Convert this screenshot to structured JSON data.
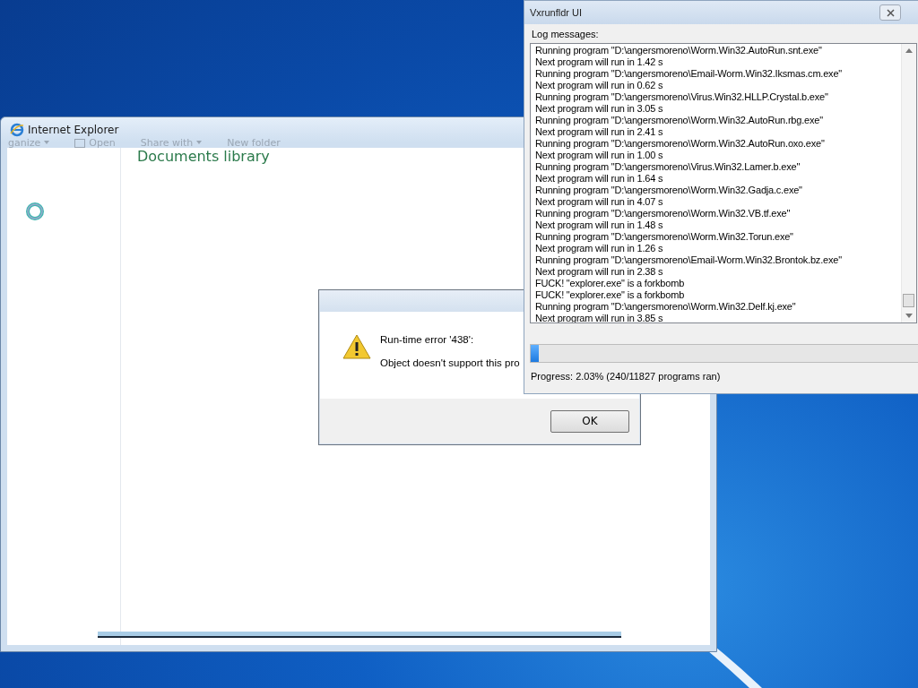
{
  "ie_window": {
    "title": "Internet Explorer",
    "toolbar": [
      {
        "label": "ganize",
        "kind": "dropdown"
      },
      {
        "label": "Open",
        "kind": "icon"
      },
      {
        "label": "Share with",
        "kind": "dropdown"
      },
      {
        "label": "New folder",
        "kind": "plain"
      }
    ],
    "heading": "Documents library"
  },
  "error_dialog": {
    "heading": "Run-time error '438':",
    "message": "Object doesn't support this pro",
    "buttons": [
      "OK"
    ]
  },
  "runner_window": {
    "title": "Vxrunfldr UI",
    "log_label": "Log messages:",
    "log": [
      "Running program \"D:\\angersmoreno\\Worm.Win32.AutoRun.snt.exe\"",
      "Next program will run in 1.42 s",
      "Running program \"D:\\angersmoreno\\Email-Worm.Win32.Iksmas.cm.exe\"",
      "Next program will run in 0.62 s",
      "Running program \"D:\\angersmoreno\\Virus.Win32.HLLP.Crystal.b.exe\"",
      "Next program will run in 3.05 s",
      "Running program \"D:\\angersmoreno\\Worm.Win32.AutoRun.rbg.exe\"",
      "Next program will run in 2.41 s",
      "Running program \"D:\\angersmoreno\\Worm.Win32.AutoRun.oxo.exe\"",
      "Next program will run in 1.00 s",
      "Running program \"D:\\angersmoreno\\Virus.Win32.Lamer.b.exe\"",
      "Next program will run in 1.64 s",
      "Running program \"D:\\angersmoreno\\Worm.Win32.Gadja.c.exe\"",
      "Next program will run in 4.07 s",
      "Running program \"D:\\angersmoreno\\Worm.Win32.VB.tf.exe\"",
      "Next program will run in 1.48 s",
      "Running program \"D:\\angersmoreno\\Worm.Win32.Torun.exe\"",
      "Next program will run in 1.26 s",
      "Running program \"D:\\angersmoreno\\Email-Worm.Win32.Brontok.bz.exe\"",
      "Next program will run in 2.38 s",
      "FUCK! \"explorer.exe\" is a forkbomb",
      "FUCK! \"explorer.exe\" is a forkbomb",
      "Running program \"D:\\angersmoreno\\Worm.Win32.Delf.kj.exe\"",
      "Next program will run in 3.85 s"
    ],
    "progress": {
      "level": 0.0203
    },
    "status": "Progress: 2.03% (240/11827 programs ran)"
  }
}
